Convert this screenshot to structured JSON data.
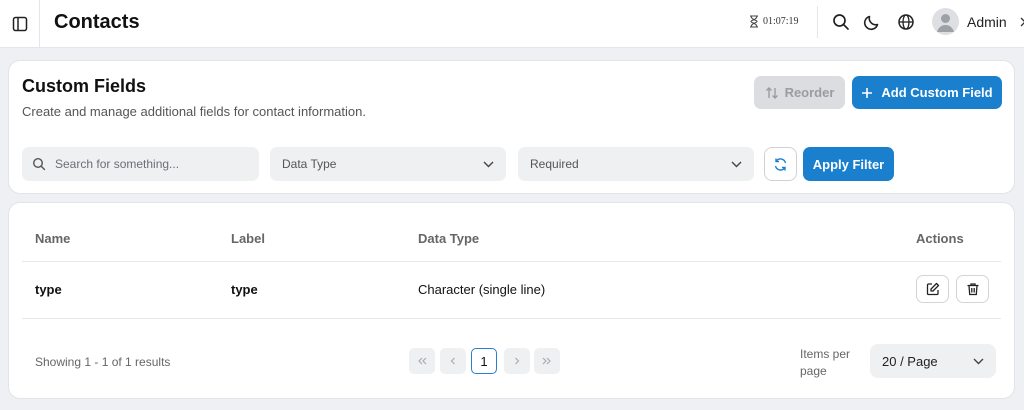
{
  "header": {
    "title": "Contacts",
    "timer": "01:07:19",
    "user_name": "Admin"
  },
  "page": {
    "title": "Custom Fields",
    "subtitle": "Create and manage additional fields for contact information.",
    "reorder_label": "Reorder",
    "add_label": "Add Custom Field"
  },
  "filters": {
    "search_placeholder": "Search for something...",
    "data_type_label": "Data Type",
    "required_label": "Required",
    "apply_label": "Apply Filter"
  },
  "table": {
    "columns": [
      "Name",
      "Label",
      "Data Type",
      "Actions"
    ],
    "rows": [
      {
        "name": "type",
        "label": "type",
        "data_type": "Character (single line)"
      }
    ]
  },
  "pagination": {
    "showing": "Showing 1 - 1 of 1 results",
    "current_page": "1",
    "items_per_page_label": "Items per page",
    "per_page_value": "20 / Page"
  },
  "colors": {
    "primary": "#1a7fcd",
    "disabled": "#dcdde0"
  }
}
